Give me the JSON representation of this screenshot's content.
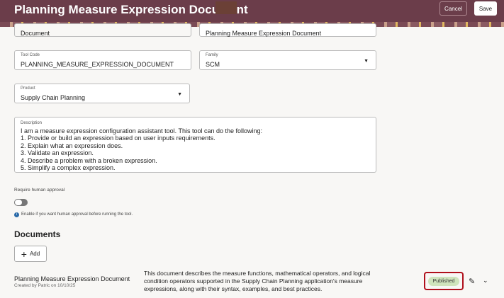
{
  "header": {
    "title": "Planning Measure Expression Document",
    "cancel": "Cancel",
    "save": "Save"
  },
  "fields": {
    "type_value": "Document",
    "name_value": "Planning Measure Expression Document",
    "tool_code_label": "Tool Code",
    "tool_code_value": "PLANNING_MEASURE_EXPRESSION_DOCUMENT",
    "family_label": "Family",
    "family_value": "SCM",
    "product_label": "Product",
    "product_value": "Supply Chain Planning",
    "description_label": "Description",
    "description_lines": [
      "I am a measure expression configuration assistant tool. This tool can do the following:",
      "1. Provide or build an expression based on user inputs requirements.",
      "2. Explain what an expression does.",
      "3. Validate an expression.",
      "4. Describe a problem with a broken expression.",
      "5. Simplify a complex expression."
    ]
  },
  "approval": {
    "label": "Require human approval",
    "enabled": false,
    "help": "Enable if you want human approval before running the tool."
  },
  "documents": {
    "heading": "Documents",
    "add_label": "Add",
    "items": [
      {
        "name": "Planning Measure Expression Document",
        "created": "Created by Patric on 10/10/25",
        "description": "This document describes the measure functions, mathematical operators, and logical condition operators supported in the Supply Chain Planning application's measure expressions, along with their syntax, examples, and best practices.",
        "status": "Published"
      }
    ]
  }
}
